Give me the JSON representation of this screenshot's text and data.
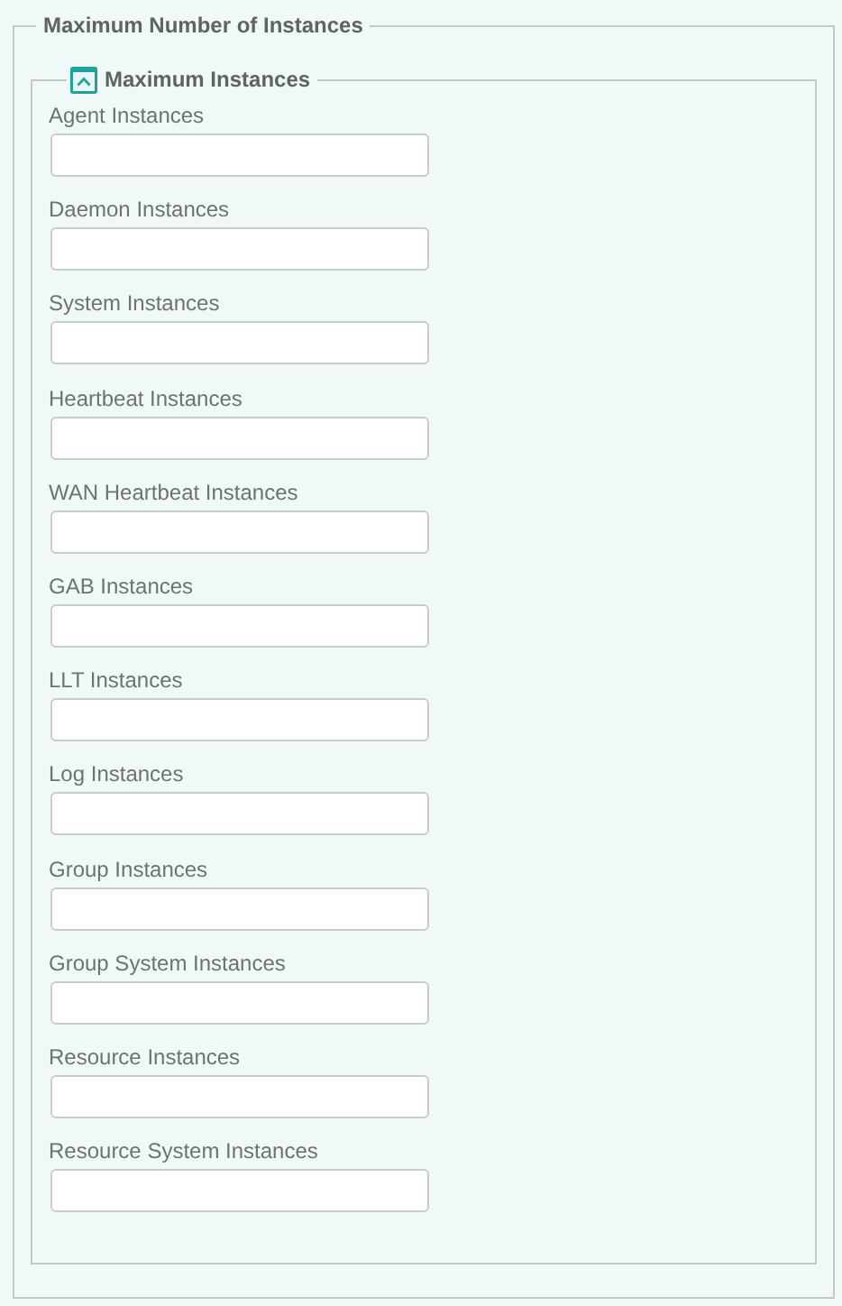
{
  "section": {
    "title": "Maximum Number of Instances"
  },
  "group": {
    "title": "Maximum Instances",
    "expanded": true,
    "fields": [
      {
        "label": "Agent Instances"
      },
      {
        "label": "Daemon Instances"
      },
      {
        "label": "System Instances"
      },
      {
        "label": "Heartbeat Instances"
      },
      {
        "label": "WAN Heartbeat Instances"
      },
      {
        "label": "GAB Instances"
      },
      {
        "label": "LLT Instances"
      },
      {
        "label": "Log Instances"
      },
      {
        "label": "Group Instances"
      },
      {
        "label": "Group System Instances"
      },
      {
        "label": "Resource Instances"
      },
      {
        "label": "Resource System Instances"
      }
    ]
  }
}
